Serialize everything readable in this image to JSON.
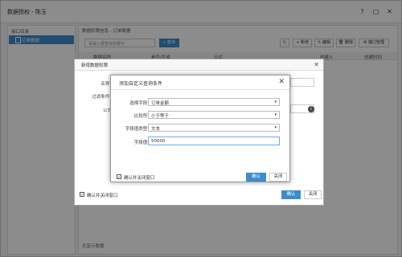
{
  "window": {
    "title": "数据授权 - 陈玉",
    "icons": [
      "help-icon",
      "maximize-icon",
      "close-icon"
    ]
  },
  "sidebar": {
    "header": "接口目录",
    "selected_item": "订单数据"
  },
  "main": {
    "breadcrumb": "数据权限信息 - 订单数据",
    "search_placeholder": "请输入要查询关键字",
    "query_label": "查询",
    "toolbar": {
      "add": "新增",
      "edit": "编辑",
      "delete": "删除",
      "manage": "接口管理"
    },
    "columns": [
      "数据名称",
      "是否/生成",
      "公式",
      "创建人",
      "创建时间"
    ],
    "footer": "无显示数据"
  },
  "outer_dialog": {
    "title": "新增数据权限",
    "fields": {
      "name_label": "名称",
      "filter_label": "过滤条件",
      "formula_label": "公式"
    },
    "confirm_close_label": "确认并关闭窗口",
    "ok_label": "确认",
    "close_label": "关闭"
  },
  "inner_dialog": {
    "title": "添加自定义查询条件",
    "rows": {
      "field_label": "选择字段",
      "field_value": "订单金额",
      "compare_label": "比较符",
      "compare_value": "小于等于",
      "type_label": "字段值类型",
      "type_value": "文本",
      "value_label": "字段值",
      "value_value": "50000"
    },
    "confirm_close_label": "确认并关闭窗口",
    "ok_label": "确认",
    "close_label": "关闭"
  },
  "colors": {
    "accent": "#3c8dcc",
    "overlay": "rgba(0,0,0,0.45)"
  }
}
